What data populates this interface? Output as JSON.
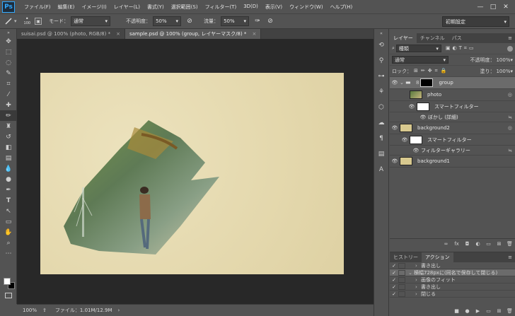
{
  "app": {
    "logo": "Ps"
  },
  "menu": [
    "ファイル(F)",
    "編集(E)",
    "イメージ(I)",
    "レイヤー(L)",
    "書式(Y)",
    "選択範囲(S)",
    "フィルター(T)",
    "3D(D)",
    "表示(V)",
    "ウィンドウ(W)",
    "ヘルプ(H)"
  ],
  "window_controls": {
    "minimize": "—",
    "maximize": "□",
    "close": "✕"
  },
  "options": {
    "brush_size": "100",
    "mode_label": "モード：",
    "mode_value": "通常",
    "opacity_label": "不透明度：",
    "opacity_value": "50%",
    "flow_label": "流量：",
    "flow_value": "50%",
    "workspace": "初期設定"
  },
  "tabs": [
    {
      "label": "suisai.psd @ 100% (photo, RGB/8) *",
      "close": "×"
    },
    {
      "label": "sample.psd @ 100% (group, レイヤーマスク/8) *",
      "close": "×"
    }
  ],
  "status": {
    "zoom": "100%",
    "file_info": "ファイル：1.01M/12.9M"
  },
  "layers_panel": {
    "tabs": [
      "レイヤー",
      "チャンネル",
      "パス"
    ],
    "menu_icon": "≡",
    "filter_kind": "種類",
    "blend_mode": "通常",
    "opacity_label": "不透明度：",
    "opacity_value": "100%",
    "lock_label": "ロック：",
    "fill_label": "塗り：",
    "fill_value": "100%",
    "layers": [
      {
        "name": "group",
        "eye": "👁",
        "right": ""
      },
      {
        "name": "photo",
        "eye": "",
        "right": "◎"
      },
      {
        "name": "スマートフィルター",
        "eye": "👁",
        "right": ""
      },
      {
        "name": "ぼかし (詳細)",
        "eye": "👁",
        "right": "≒"
      },
      {
        "name": "background2",
        "eye": "👁",
        "right": "◎"
      },
      {
        "name": "スマートフィルター",
        "eye": "👁",
        "right": ""
      },
      {
        "name": "フィルターギャラリー",
        "eye": "👁",
        "right": "≒"
      },
      {
        "name": "background1",
        "eye": "👁",
        "right": ""
      }
    ],
    "footer_icons": [
      "∞",
      "fx",
      "◘",
      "◐",
      "▭",
      "⊞",
      "🗑"
    ]
  },
  "actions_panel": {
    "tabs": [
      "ヒストリー",
      "アクション"
    ],
    "menu_icon": "≡",
    "rows": [
      {
        "check": "✓",
        "twist": "›",
        "label": "書き出し"
      },
      {
        "check": "✓",
        "twist": "⌄",
        "label": "横幅728pxに(同名で保存して閉じる)"
      },
      {
        "check": "✓",
        "twist": "›",
        "label": "画像のフィット"
      },
      {
        "check": "✓",
        "twist": "›",
        "label": "書き出し"
      },
      {
        "check": "✓",
        "twist": "›",
        "label": "閉じる"
      }
    ],
    "footer_icons": [
      "■",
      "●",
      "▶",
      "▭",
      "⊞",
      "🗑"
    ]
  },
  "colors": {
    "foreground": "#ffffff",
    "background": "#000000"
  }
}
